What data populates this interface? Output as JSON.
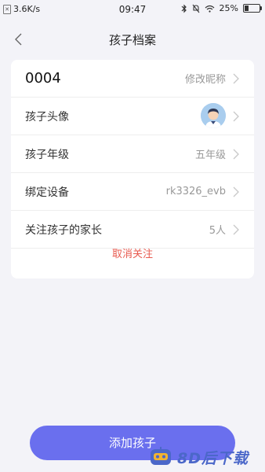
{
  "status_bar": {
    "network_speed": "3.6K/s",
    "time": "09:47",
    "battery_percent": "25%",
    "battery_level": 0.25,
    "icons": [
      "bluetooth-icon",
      "mute-icon",
      "wifi-icon",
      "battery-icon"
    ]
  },
  "nav": {
    "title": "孩子档案",
    "back_icon": "chevron-left-icon"
  },
  "profile": {
    "nickname_value": "0004",
    "nickname_action": "修改昵称",
    "rows": [
      {
        "label": "孩子头像",
        "value": "",
        "type": "avatar"
      },
      {
        "label": "孩子年级",
        "value": "五年级"
      },
      {
        "label": "绑定设备",
        "value": "rk3326_evb"
      },
      {
        "label": "关注孩子的家长",
        "value": "5人"
      }
    ],
    "cancel_follow": "取消关注"
  },
  "footer": {
    "add_child_label": "添加孩子"
  },
  "watermark": {
    "text": "8D后下载"
  },
  "colors": {
    "accent": "#6a6fee",
    "danger": "#e85a4f",
    "background": "#f3f3f8"
  }
}
